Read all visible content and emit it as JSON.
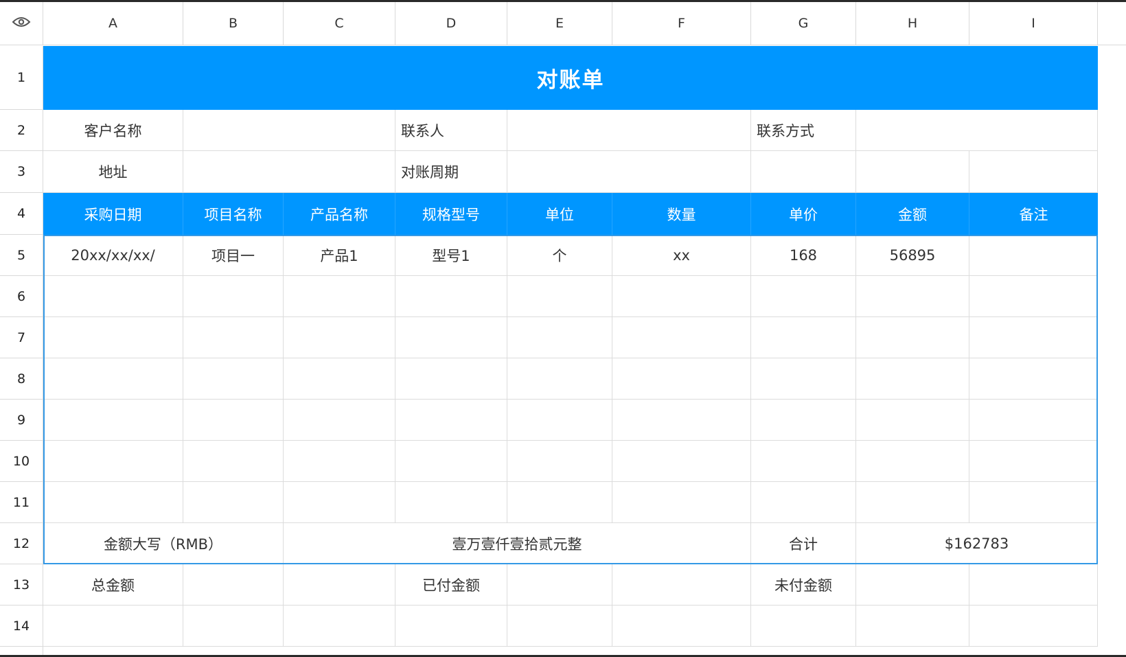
{
  "columns": [
    "A",
    "B",
    "C",
    "D",
    "E",
    "F",
    "G",
    "H",
    "I"
  ],
  "rows": [
    "1",
    "2",
    "3",
    "4",
    "5",
    "6",
    "7",
    "8",
    "9",
    "10",
    "11",
    "12",
    "13",
    "14"
  ],
  "title": "对账单",
  "info": {
    "customer_label": "客户名称",
    "contact_label": "联系人",
    "contact_method_label": "联系方式",
    "address_label": "地址",
    "period_label": "对账周期"
  },
  "headers": [
    "采购日期",
    "项目名称",
    "产品名称",
    "规格型号",
    "单位",
    "数量",
    "单价",
    "金额",
    "备注"
  ],
  "row5": [
    "20xx/xx/xx/",
    "项目一",
    "产品1",
    "型号1",
    "个",
    "xx",
    "168",
    "56895",
    ""
  ],
  "summary": {
    "amount_words_label": "金额大写（RMB）",
    "amount_words_value": "壹万壹仟壹拾贰元整",
    "total_label": "合计",
    "total_value": "$162783"
  },
  "footer": {
    "total_amount_label": "总金额",
    "paid_label": "已付金额",
    "unpaid_label": "未付金额"
  },
  "icons": {
    "visibility": "eye-icon"
  },
  "colors": {
    "header_blue": "#0096ff",
    "selection_border": "#3399e6"
  }
}
